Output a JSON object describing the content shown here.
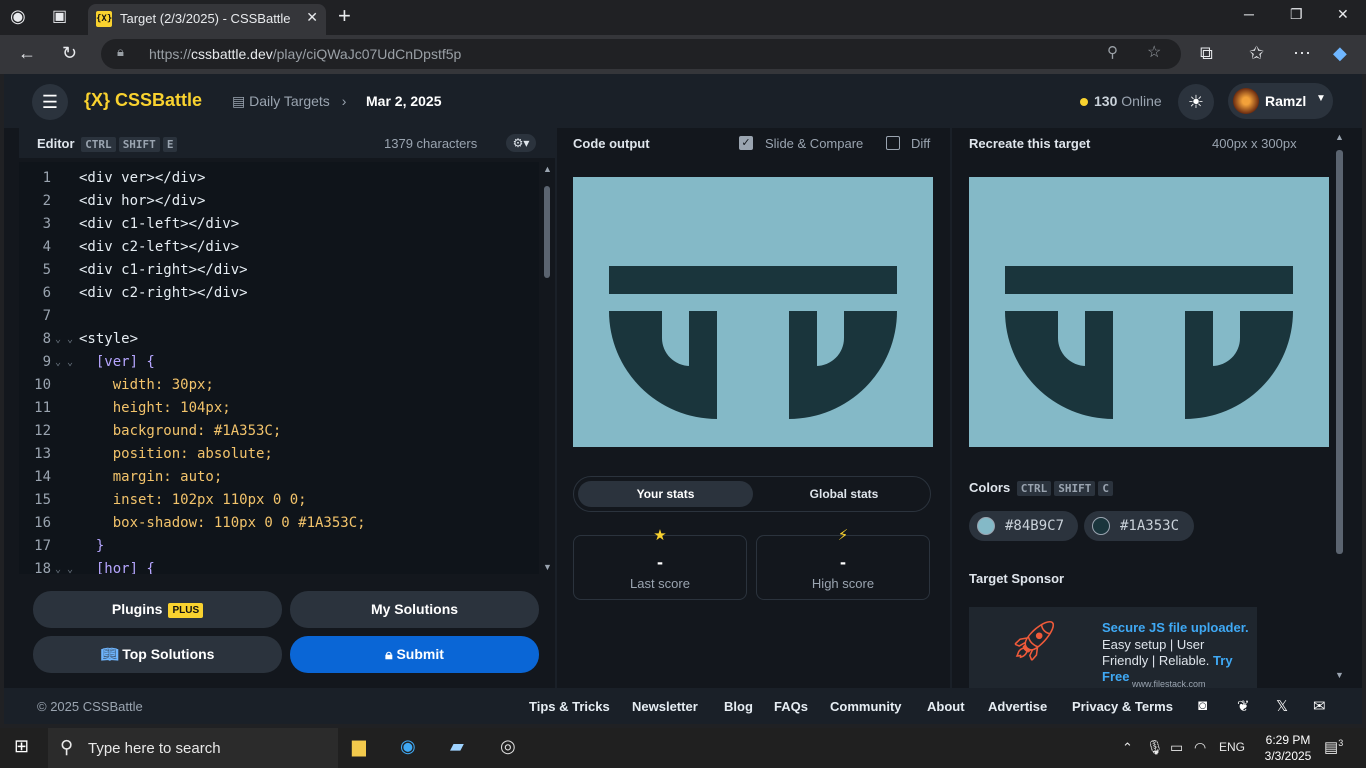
{
  "browser": {
    "tab_title": "Target (2/3/2025) - CSSBattle",
    "tab_favicon": "{X}",
    "url_prefix": "https://",
    "url_host": "cssbattle.dev",
    "url_path": "/play/ciQWaJc07UdCnDpstf5p"
  },
  "header": {
    "logo": "{X} CSSBattle",
    "breadcrumb": "Daily Targets",
    "breadcrumb_date": "Mar 2, 2025",
    "online_count": "130",
    "online_label": "Online",
    "user_name": "Ramzl"
  },
  "editor": {
    "title": "Editor",
    "shortcut": [
      "CTRL",
      "SHIFT",
      "E"
    ],
    "characters": "1379 characters",
    "line_numbers": [
      "1",
      "2",
      "3",
      "4",
      "5",
      "6",
      "7",
      "8",
      "9",
      "10",
      "11",
      "12",
      "13",
      "14",
      "15",
      "16",
      "17",
      "18"
    ],
    "lines": [
      "<div ver></div>",
      "<div hor></div>",
      "<div c1-left></div>",
      "<div c2-left></div>",
      "<div c1-right></div>",
      "<div c2-right></div>",
      "",
      "<style>",
      "  [ver] {",
      "    width: 30px;",
      "    height: 104px;",
      "    background: #1A353C;",
      "    position: absolute;",
      "    margin: auto;",
      "    inset: 102px 110px 0 0;",
      "    box-shadow: 110px 0 0 #1A353C;",
      "  }",
      "  [hor] {"
    ]
  },
  "buttons": {
    "plugins": "Plugins",
    "plugins_badge": "PLUS",
    "my_solutions": "My Solutions",
    "top_solutions": "Top Solutions",
    "submit": "Submit"
  },
  "output": {
    "title": "Code output",
    "slide_compare": "Slide & Compare",
    "diff": "Diff",
    "stats_tabs": [
      "Your stats",
      "Global stats"
    ],
    "last_score_value": "-",
    "last_score_label": "Last score",
    "high_score_value": "-",
    "high_score_label": "High score"
  },
  "target": {
    "title": "Recreate this target",
    "size": "400px x 300px",
    "colors_title": "Colors",
    "colors_shortcut": [
      "CTRL",
      "SHIFT",
      "C"
    ],
    "colors": [
      "#84B9C7",
      "#1A353C"
    ],
    "sponsor_title": "Target Sponsor",
    "sponsor_headline": "Secure JS file uploader.",
    "sponsor_body": "Easy setup | User Friendly | Reliable.",
    "sponsor_cta": "Try Free",
    "sponsor_url": "www.filestack.com"
  },
  "footer": {
    "copyright": "© 2025 CSSBattle",
    "links": [
      "Tips & Tricks",
      "Newsletter",
      "Blog",
      "FAQs",
      "Community",
      "About",
      "Advertise",
      "Privacy & Terms"
    ]
  },
  "taskbar": {
    "search_placeholder": "Type here to search",
    "language": "ENG",
    "time": "6:29 PM",
    "date": "3/3/2025",
    "notifications": "3"
  }
}
